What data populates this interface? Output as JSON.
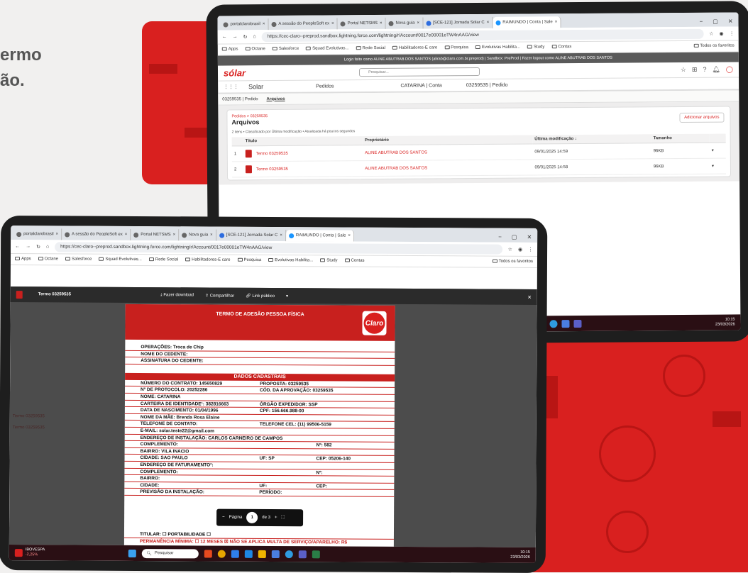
{
  "headline": {
    "line1": "ermo",
    "line2": "ão."
  },
  "browser": {
    "tabs": [
      "portalclarobrasil",
      "A sessão do PeopleSoft ex",
      "Portal NETSMS",
      "Nova guia",
      "[SCE-121] Jornada Solar C",
      "RAIMUNDO | Conta | Sale"
    ],
    "url_back": "https://cec-claro--preprod.sandbox.lightning.force.com/lightning/r/Account/0017e00001eTW4nAAG/view",
    "url_front": "https://cec-claro--preprod.sandbox.lightning.force.com/lightning/r/Account/0017e00001eTW4nAAG/view",
    "bookmarks": [
      "Apps",
      "Octane",
      "Salesforce",
      "Squad Evolutivas...",
      "Rede Social",
      "Habilitadores-E care",
      "Pesquisa",
      "Evolutivas Habilita...",
      "Study",
      "Contas",
      "Todos os favoritos"
    ]
  },
  "sf": {
    "login_banner": "Login feito como ALINE ABUTRAB DOS SANTOS (alirab@claro.com.br.preprod) | Sandbox: PreProd | Fazer logout como ALINE ABUTRAB DOS SANTOS",
    "logo": "sólar",
    "search_placeholder": "Pesquisar...",
    "app_name": "Solar",
    "nav_items": [
      "Pedidos",
      "CATARINA | Conta",
      "03259535 | Pedido"
    ],
    "subtabs": [
      "03259535 | Pedido",
      "Arquivos"
    ],
    "breadcrumb": "Pedidos > 03259535",
    "title": "Arquivos",
    "meta": "2 itens • Classificado por Última modificação • Atualizada há poucos segundos",
    "add_button": "Adicionar arquivos",
    "columns": [
      "Título",
      "Proprietário",
      "Última modificação ↓",
      "Tamanho"
    ],
    "rows": [
      {
        "n": "1",
        "title": "Termo 03259535",
        "owner": "ALINE ABUTRAB DOS SANTOS",
        "modified": "09/01/2025 14:59",
        "size": "96KB"
      },
      {
        "n": "2",
        "title": "Termo 03259535",
        "owner": "ALINE ABUTRAB DOS SANTOS",
        "modified": "09/01/2025 14:58",
        "size": "96KB"
      }
    ]
  },
  "taskbar": {
    "time": "10:15",
    "date": "23/03/2026",
    "search": "Pesquisar",
    "stock_name": "IBOVESPA",
    "stock_change": "-2,25%"
  },
  "viewer": {
    "filename": "Termo 03259535",
    "download": "Fazer download",
    "share": "Compartilhar",
    "public_link": "Link público",
    "close": "×"
  },
  "doc": {
    "title": "TERMO DE ADESÃO PESSOA FÍSICA",
    "brand": "Claro",
    "rows1": [
      "OPERAÇÕES: Troca de Chip",
      "NOME DO CEDENTE:",
      "ASSINATURA DO CEDENTE:"
    ],
    "section": "DADOS CADASTRAIS",
    "contract": "NÚMERO DO CONTRATO: 145650829",
    "proposal": "PROPOSTA: 03259535",
    "protocol": "Nº DE PROTOCOLO: 20252286",
    "approval": "CÓD. DA APROVAÇÃO: 03259535",
    "name": "NOME: CATARINA",
    "id": "CARTEIRA DE IDENTIDADE¹: 382816663",
    "issuer": "ÓRGÃO EXPEDIDOR: SSP",
    "birth": "DATA DE NASCIMENTO: 01/04/1996",
    "cpf": "CPF: 156.666.988-00",
    "mother": "NOME DA MÃE: Brenda Rosa Elaine",
    "phone": "TELEFONE DE CONTATO:",
    "cell": "TELEFONE CEL: (11) 99506-5159",
    "email": "E-MAIL: solar.teste22@gmail.com",
    "install_addr": "ENDEREÇO DE INSTALAÇÃO: CARLOS CARNEIRO DE CAMPOS",
    "complement": "COMPLEMENTO:",
    "number": "Nº: 582",
    "district": "BAIRRO: VILA INACIO",
    "city": "CIDADE: SAO PAULO",
    "uf": "UF: SP",
    "cep": "CEP: 05206-140",
    "billing": "ENDEREÇO DE FATURAMENTO²:",
    "complement2": "COMPLEMENTO:",
    "number2": "Nº:",
    "district2": "BAIRRO:",
    "city2": "CIDADE:",
    "uf2": "UF:",
    "cep2": "CEP:",
    "forecast": "PREVISÃO DA INSTALAÇÃO:",
    "period": "PERÍODO:",
    "holder": "TITULAR: ☐ PORTABILIDADE ☐",
    "permanence": "PERMANÊNCIA MÍNIMA: ☐ 12 MESES  ☒ NÃO SE APLICA    MULTA DE SERVIÇO/APARELHO: R$",
    "page_label": "Página",
    "page_current": "1",
    "page_total": "de 3"
  }
}
